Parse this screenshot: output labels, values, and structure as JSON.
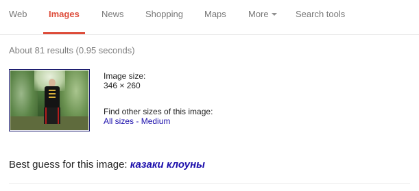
{
  "nav": {
    "tabs": [
      {
        "label": "Web"
      },
      {
        "label": "Images"
      },
      {
        "label": "News"
      },
      {
        "label": "Shopping"
      },
      {
        "label": "Maps"
      },
      {
        "label": "More"
      },
      {
        "label": "Search tools"
      }
    ],
    "active_tab": "Images"
  },
  "stats": "About 81 results (0.95 seconds)",
  "image_result": {
    "size_label": "Image size:",
    "size_value": "346 × 260",
    "other_sizes_label": "Find other sizes of this image:",
    "all_sizes_link": "All sizes",
    "separator": "-",
    "medium_link": "Medium"
  },
  "best_guess": {
    "label": "Best guess for this image:",
    "query": "казаки клоуны"
  },
  "colors": {
    "active_tab": "#dd4b39",
    "link": "#1a0dab",
    "muted_text": "#777777"
  }
}
